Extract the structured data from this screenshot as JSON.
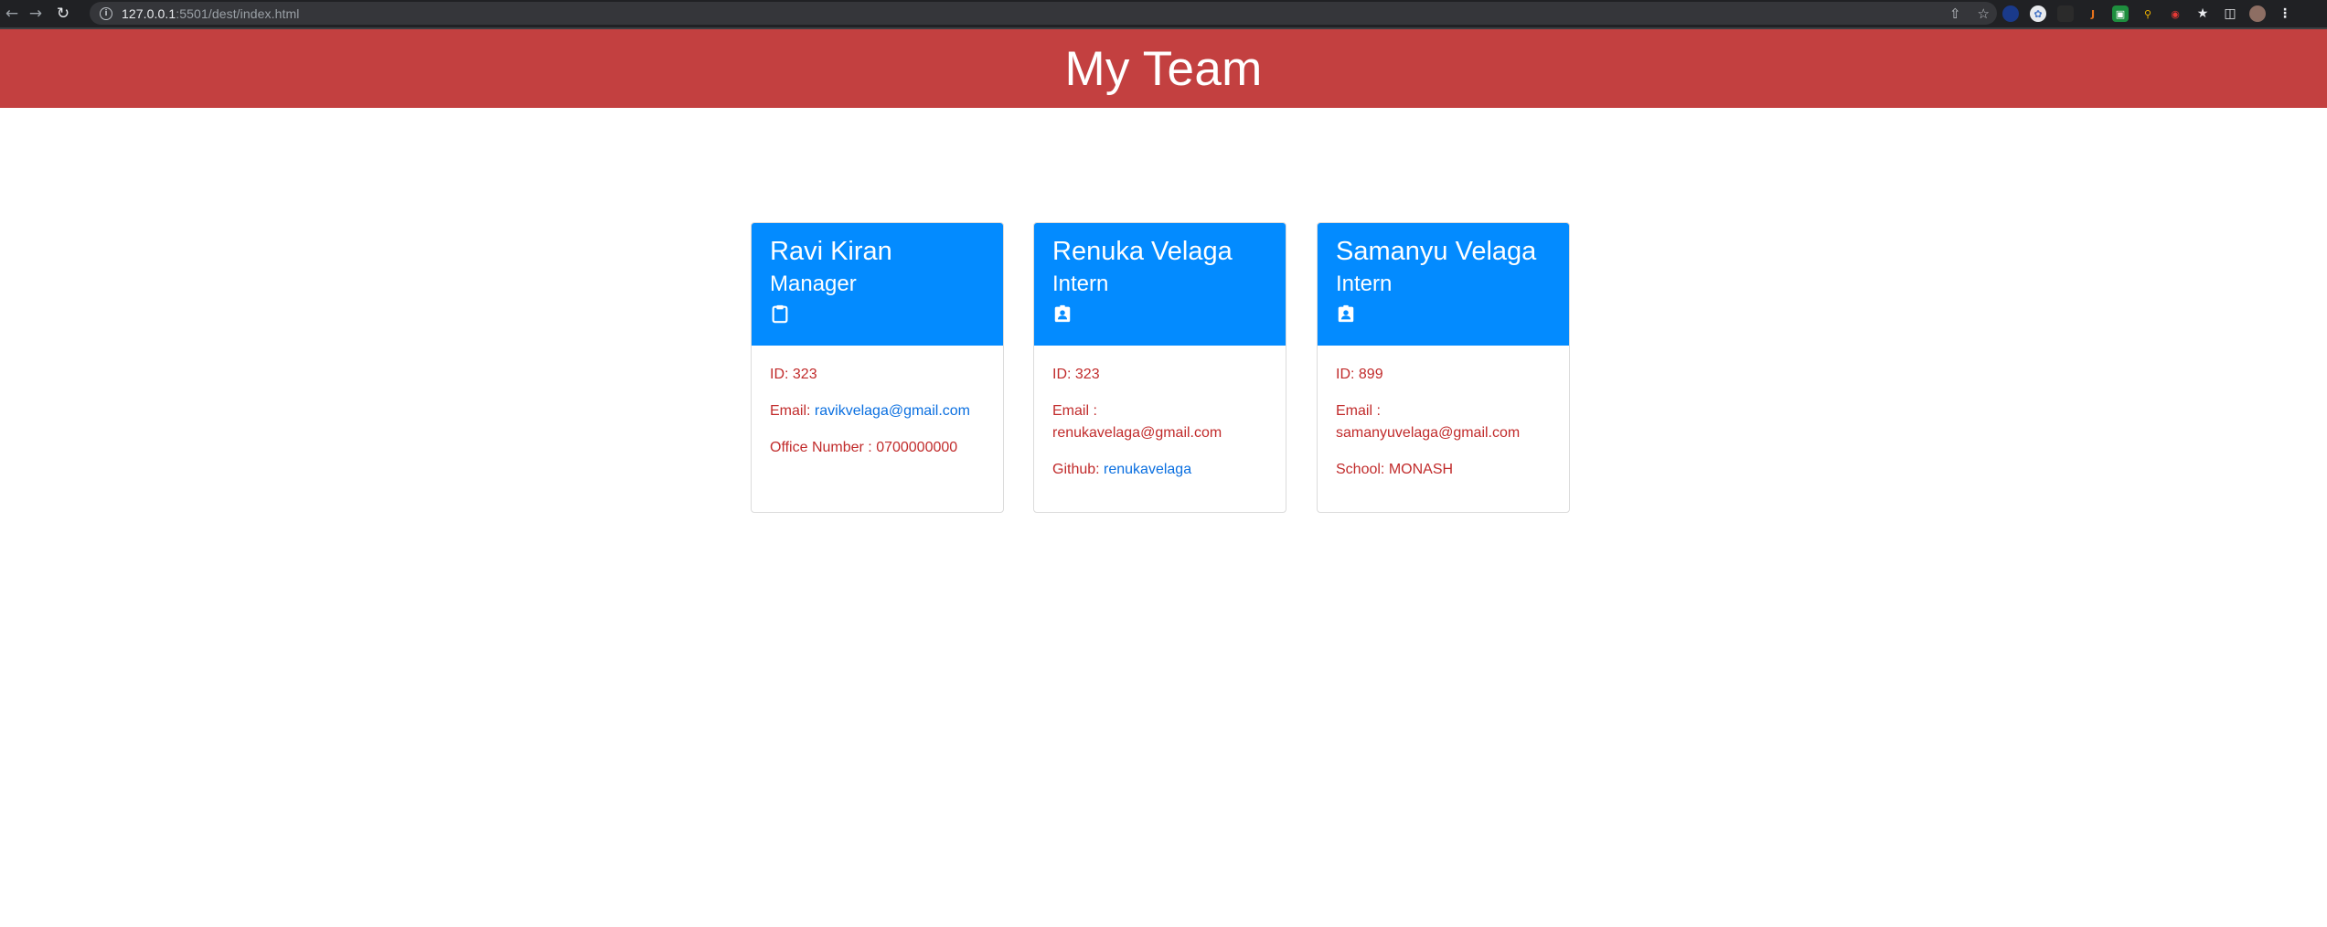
{
  "browser": {
    "url_host": "127.0.0.1",
    "url_rest": ":5501/dest/index.html"
  },
  "header": {
    "title": "My Team"
  },
  "team": [
    {
      "name": "Ravi Kiran",
      "role": "Manager",
      "icon": "clipboard-icon",
      "id_label": "ID: 323",
      "email_label": "Email: ",
      "email": "ravikvelaga@gmail.com",
      "extra_label": "Office Number : 0700000000"
    },
    {
      "name": "Renuka Velaga",
      "role": "Intern",
      "icon": "id-badge-icon",
      "id_label": "ID: 323",
      "email_label": "Email :",
      "email": "renukavelaga@gmail.com",
      "extra_label": "Github: ",
      "extra_link": "renukavelaga"
    },
    {
      "name": "Samanyu Velaga",
      "role": "Intern",
      "icon": "id-badge-icon",
      "id_label": "ID: 899",
      "email_label": "Email :",
      "email": "samanyuvelaga@gmail.com",
      "extra_label": "School: MONASH"
    }
  ],
  "colors": {
    "header_bg": "#c34040",
    "card_header_bg": "#038bff",
    "body_text": "#c12b2b",
    "link": "#0a6fe0"
  }
}
